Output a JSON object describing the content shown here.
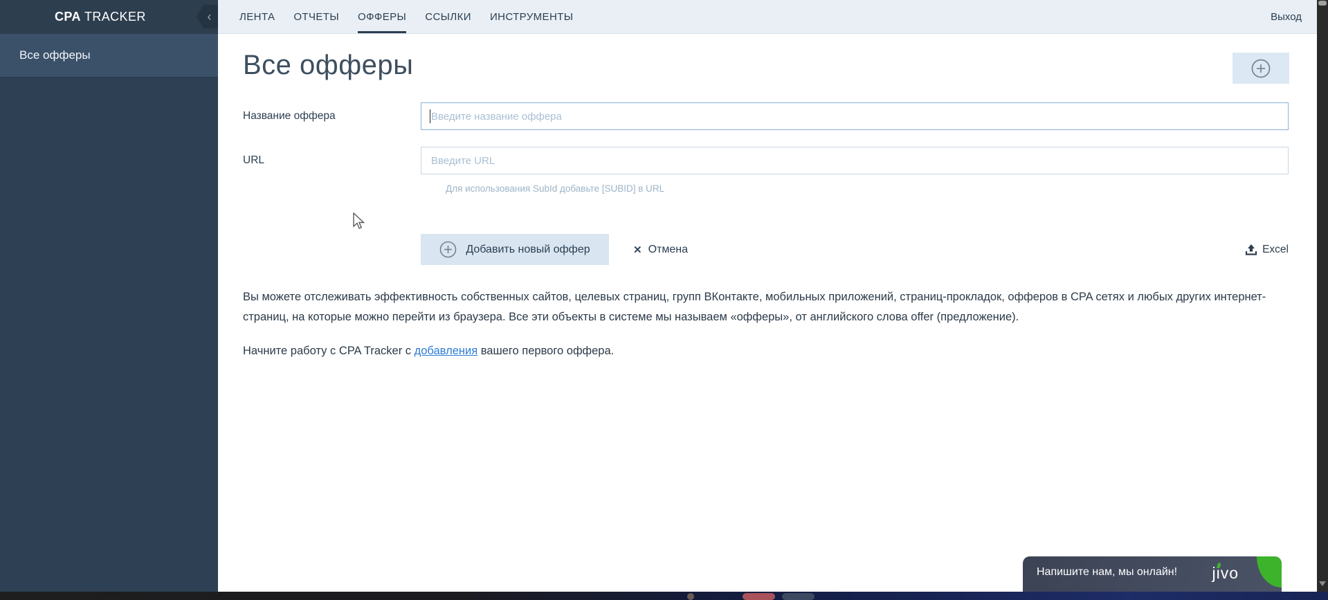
{
  "app": {
    "brand_bold": "CPA",
    "brand_rest": " TRACKER",
    "logout_label": "Выход"
  },
  "nav": {
    "tabs": [
      {
        "label": "ЛЕНТА",
        "active": false
      },
      {
        "label": "ОТЧЕТЫ",
        "active": false
      },
      {
        "label": "ОФФЕРЫ",
        "active": true
      },
      {
        "label": "ССЫЛКИ",
        "active": false
      },
      {
        "label": "ИНСТРУМЕНТЫ",
        "active": false
      }
    ]
  },
  "sidebar": {
    "items": [
      {
        "label": "Все офферы",
        "selected": true
      }
    ]
  },
  "main": {
    "title": "Все офферы",
    "form": {
      "name_label": "Название оффера",
      "name_placeholder": "Введите название оффера",
      "name_value": "",
      "url_label": "URL",
      "url_placeholder": "Введите URL",
      "url_value": "",
      "url_hint": "Для использования SubId добавьте [SUBID] в URL",
      "submit_label": "Добавить новый оффер",
      "cancel_label": "Отмена",
      "excel_label": "Excel"
    },
    "description": "Вы можете отслеживать эффективность собственных сайтов, целевых страниц, групп ВКонтакте, мобильных приложений, страниц-прокладок, офферов в CPA сетях и любых других интернет-страниц, на которые можно перейти из браузера. Все эти объекты в системе мы называем «офферы», от английского слова offer (предложение).",
    "cta_before": "Начните работу с CPA Tracker с ",
    "cta_link": "добавления",
    "cta_after": " вашего первого оффера."
  },
  "chat": {
    "message": "Напишите нам, мы онлайн!",
    "brand": "jivo"
  },
  "icons": {
    "collapse": "‹",
    "close": "✕"
  },
  "colors": {
    "header_dark": "#2d3e4f",
    "header_light": "#e9eff5",
    "sidebar": "#2e4053",
    "sidebar_selected": "#3a5169",
    "accent_button": "#d9e6f2",
    "focused_border": "#85b2d8",
    "link_blue": "#2e7cd6",
    "jivo_green": "#3db32b"
  }
}
